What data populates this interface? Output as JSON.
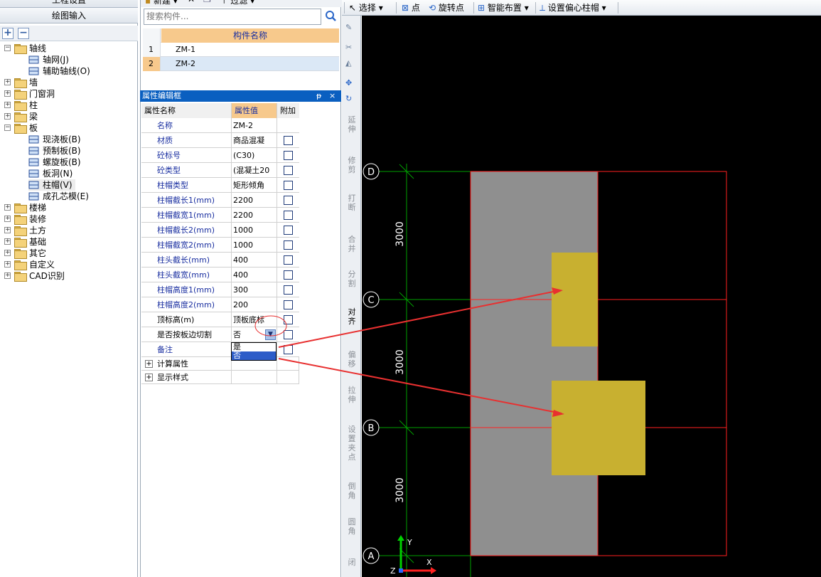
{
  "left_panel": {
    "header_top": "工程设置",
    "header_draw": "绘图输入",
    "toolbar": {
      "expand_label": "+",
      "collapse_label": "−"
    },
    "tree": [
      {
        "label": "轴线",
        "expanded": true
      },
      {
        "label": "轴网(J)",
        "child": true
      },
      {
        "label": "辅助轴线(O)",
        "child": true
      },
      {
        "label": "墙"
      },
      {
        "label": "门窗洞"
      },
      {
        "label": "柱"
      },
      {
        "label": "梁"
      },
      {
        "label": "板",
        "expanded": true
      },
      {
        "label": "现浇板(B)",
        "child": true
      },
      {
        "label": "预制板(B)",
        "child": true
      },
      {
        "label": "螺旋板(B)",
        "child": true
      },
      {
        "label": "板洞(N)",
        "child": true
      },
      {
        "label": "柱帽(V)",
        "child": true,
        "selected": true
      },
      {
        "label": "成孔芯模(E)",
        "child": true
      },
      {
        "label": "楼梯"
      },
      {
        "label": "装修"
      },
      {
        "label": "土方"
      },
      {
        "label": "基础"
      },
      {
        "label": "其它"
      },
      {
        "label": "自定义"
      },
      {
        "label": "CAD识别"
      }
    ]
  },
  "component_panel": {
    "toolbar": {
      "new_label": "新建",
      "filter_label": "过滤"
    },
    "search_placeholder": "搜索构件...",
    "table_header": "构件名称",
    "rows": [
      {
        "index": "1",
        "name": "ZM-1"
      },
      {
        "index": "2",
        "name": "ZM-2",
        "selected": true
      }
    ]
  },
  "property_editor": {
    "title": "属性编辑框",
    "pin_label": "ᵽ",
    "close_label": "×",
    "columns": [
      "属性名称",
      "属性值",
      "附加"
    ],
    "rows": [
      {
        "name": "名称",
        "value": "ZM-2",
        "checkbox": false
      },
      {
        "name": "材质",
        "value": "商品混凝",
        "checkbox": true
      },
      {
        "name": "砼标号",
        "value": "(C30)",
        "checkbox": true
      },
      {
        "name": "砼类型",
        "value": "(混凝土20",
        "checkbox": true
      },
      {
        "name": "柱帽类型",
        "value": "矩形倾角",
        "checkbox": true
      },
      {
        "name": "柱帽截长1(mm)",
        "value": "2200",
        "checkbox": true
      },
      {
        "name": "柱帽截宽1(mm)",
        "value": "2200",
        "checkbox": true
      },
      {
        "name": "柱帽截长2(mm)",
        "value": "1000",
        "checkbox": true
      },
      {
        "name": "柱帽截宽2(mm)",
        "value": "1000",
        "checkbox": true
      },
      {
        "name": "柱头截长(mm)",
        "value": "400",
        "checkbox": true
      },
      {
        "name": "柱头截宽(mm)",
        "value": "400",
        "checkbox": true
      },
      {
        "name": "柱帽高度1(mm)",
        "value": "300",
        "checkbox": true
      },
      {
        "name": "柱帽高度2(mm)",
        "value": "200",
        "checkbox": true
      },
      {
        "name": "顶标高(m)",
        "value": "顶板底标",
        "checkbox": true,
        "black": true
      },
      {
        "name": "是否按板边切割",
        "value": "否",
        "checkbox": true,
        "black": true,
        "dropdown": true
      },
      {
        "name": "备注",
        "value": "",
        "checkbox": true
      }
    ],
    "groups": [
      {
        "label": "计算属性"
      },
      {
        "label": "显示样式"
      }
    ],
    "dropdown_options": [
      "是",
      "否"
    ],
    "dropdown_selected": "否"
  },
  "top_toolbar": {
    "select_label": "选择",
    "point_label": "点",
    "rotate_point_label": "旋转点",
    "smart_layout_label": "智能布置",
    "set_offset_label": "设置偏心柱帽"
  },
  "tools_strip": [
    {
      "label": "延伸"
    },
    {
      "label": "修剪"
    },
    {
      "label": "打断"
    },
    {
      "label": "合并"
    },
    {
      "label": "分割"
    },
    {
      "label": "对齐",
      "active": true
    },
    {
      "label": "偏移"
    },
    {
      "label": "拉伸"
    },
    {
      "label": "设置夹点"
    },
    {
      "label": "倒角"
    },
    {
      "label": "圆角"
    },
    {
      "label": "闭"
    }
  ],
  "canvas": {
    "axis_labels": [
      "D",
      "C",
      "B",
      "A"
    ],
    "dimensions": [
      "3000",
      "3000",
      "3000"
    ],
    "ucs": {
      "y": "Y",
      "x": "X",
      "z": "Z"
    },
    "colors": {
      "background": "#000000",
      "grid": "#00a000",
      "slab_outline": "#ff2020",
      "slab_fill": "#8f8f8f",
      "column_cap": "#c8b030",
      "annotation": "#e83030"
    }
  }
}
